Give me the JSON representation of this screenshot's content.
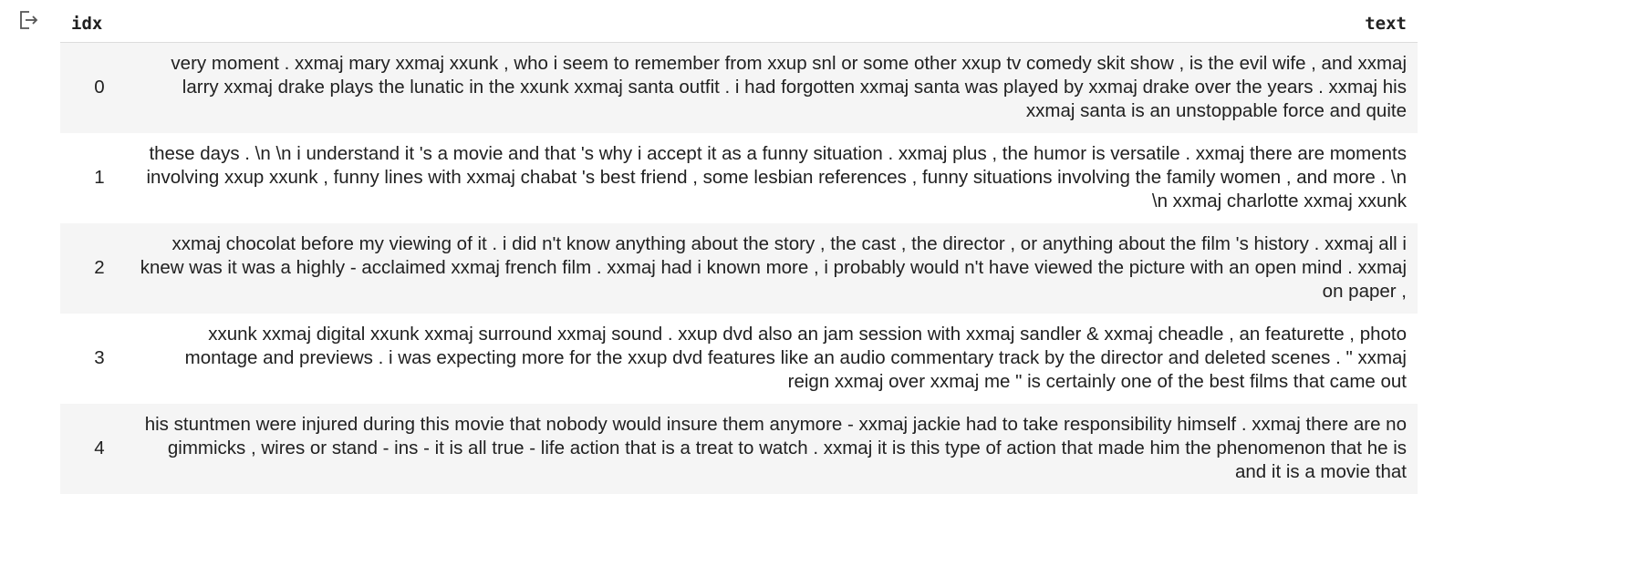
{
  "output": {
    "icon": "output-redirect-icon"
  },
  "table": {
    "headers": {
      "idx": "idx",
      "text": "text"
    },
    "rows": [
      {
        "idx": "0",
        "text": "very moment . xxmaj mary xxmaj xxunk , who i seem to remember from xxup snl or some other xxup tv comedy skit show , is the evil wife , and xxmaj larry xxmaj drake plays the lunatic in the xxunk xxmaj santa outfit . i had forgotten xxmaj santa was played by xxmaj drake over the years . xxmaj his xxmaj santa is an unstoppable force and quite"
      },
      {
        "idx": "1",
        "text": "these days . \\n \\n i understand it 's a movie and that 's why i accept it as a funny situation . xxmaj plus , the humor is versatile . xxmaj there are moments involving xxup xxunk , funny lines with xxmaj chabat 's best friend , some lesbian references , funny situations involving the family women , and more . \\n \\n xxmaj charlotte xxmaj xxunk"
      },
      {
        "idx": "2",
        "text": "xxmaj chocolat before my viewing of it . i did n't know anything about the story , the cast , the director , or anything about the film 's history . xxmaj all i knew was it was a highly - acclaimed xxmaj french film . xxmaj had i known more , i probably would n't have viewed the picture with an open mind . xxmaj on paper ,"
      },
      {
        "idx": "3",
        "text": "xxunk xxmaj digital xxunk xxmaj surround xxmaj sound . xxup dvd also an jam session with xxmaj sandler & xxmaj cheadle , an featurette , photo montage and previews . i was expecting more for the xxup dvd features like an audio commentary track by the director and deleted scenes . \" xxmaj reign xxmaj over xxmaj me \" is certainly one of the best films that came out"
      },
      {
        "idx": "4",
        "text": "his stuntmen were injured during this movie that nobody would insure them anymore - xxmaj jackie had to take responsibility himself . xxmaj there are no gimmicks , wires or stand - ins - it is all true - life action that is a treat to watch . xxmaj it is this type of action that made him the phenomenon that he is and it is a movie that"
      }
    ]
  }
}
